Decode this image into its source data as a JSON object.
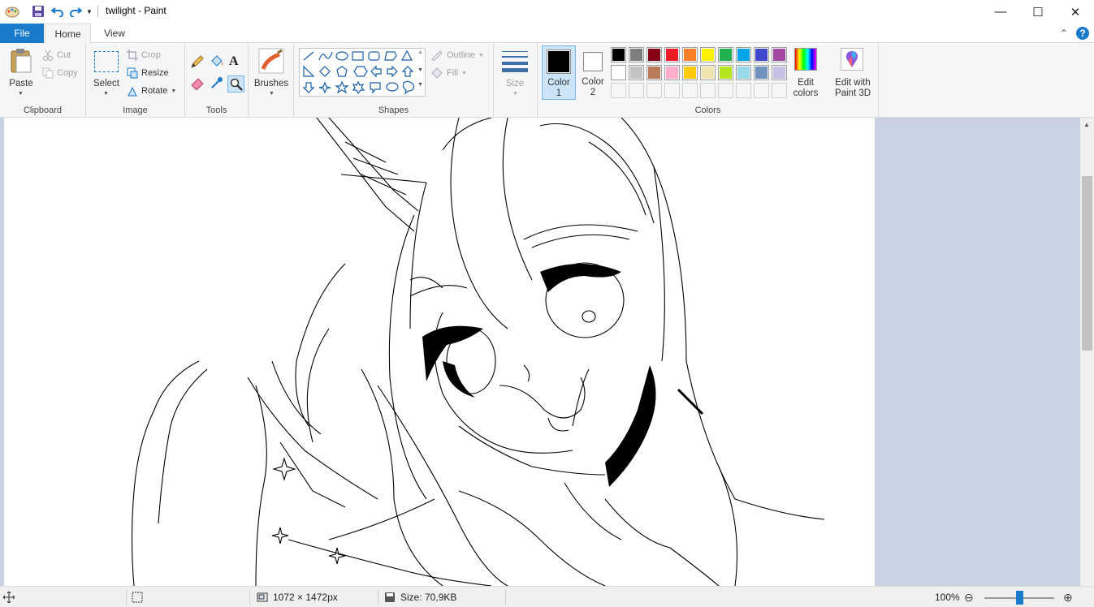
{
  "window": {
    "title": "twilight - Paint",
    "minimize_glyph": "—",
    "maximize_glyph": "☐",
    "close_glyph": "✕"
  },
  "ribbon_tabs": {
    "file": "File",
    "home": "Home",
    "view": "View"
  },
  "help": {
    "collapse_glyph": "⌃",
    "help_glyph": "?"
  },
  "clipboard": {
    "paste": "Paste",
    "cut": "Cut",
    "copy": "Copy",
    "label": "Clipboard"
  },
  "image": {
    "select": "Select",
    "crop": "Crop",
    "resize": "Resize",
    "rotate": "Rotate",
    "label": "Image"
  },
  "tools": {
    "label": "Tools",
    "text_glyph": "A"
  },
  "brushes": {
    "label": "Brushes"
  },
  "shapes": {
    "label": "Shapes",
    "outline": "Outline",
    "fill": "Fill"
  },
  "size": {
    "label": "Size"
  },
  "colors": {
    "color1_line1": "Color",
    "color1_line2": "1",
    "color2_line1": "Color",
    "color2_line2": "2",
    "edit_colors_line1": "Edit",
    "edit_colors_line2": "colors",
    "edit_3d_line1": "Edit with",
    "edit_3d_line2": "Paint 3D",
    "label": "Colors",
    "color1_value": "#000000",
    "color2_value": "#ffffff",
    "palette_row1": [
      "#000000",
      "#7f7f7f",
      "#880015",
      "#ed1c24",
      "#ff7f27",
      "#fff200",
      "#22b14c",
      "#00a2e8",
      "#3f48cc",
      "#a349a4"
    ],
    "palette_row2": [
      "#ffffff",
      "#c3c3c3",
      "#b97a57",
      "#ffaec9",
      "#ffc90e",
      "#efe4b0",
      "#b5e61d",
      "#99d9ea",
      "#7092be",
      "#c8bfe7"
    ],
    "palette_row3": [
      "#ffffff",
      "#ffffff",
      "#ffffff",
      "#ffffff",
      "#ffffff",
      "#ffffff",
      "#ffffff",
      "#ffffff",
      "#ffffff",
      "#ffffff"
    ]
  },
  "status": {
    "dimensions": "1072 × 1472px",
    "size": "Size: 70,9KB",
    "zoom": "100%",
    "zoom_level": 1.0,
    "minus_glyph": "⊖",
    "plus_glyph": "⊕"
  }
}
